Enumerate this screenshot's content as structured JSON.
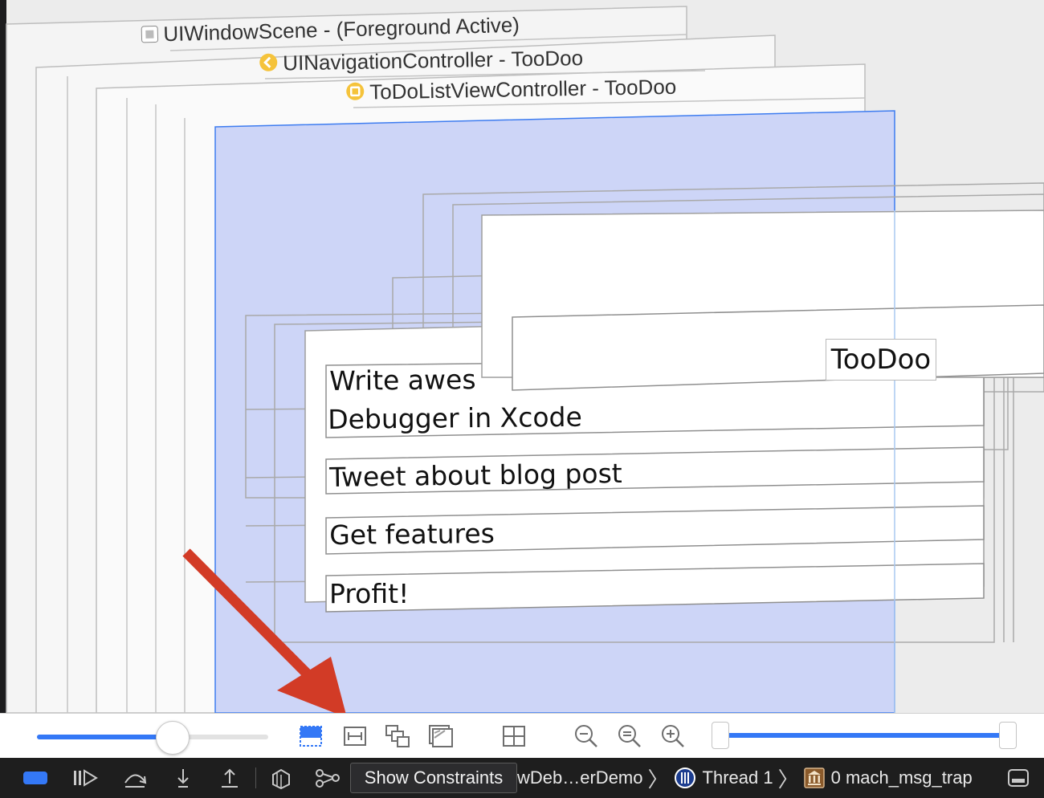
{
  "scene": {
    "window_scene_label": "UIWindowScene - (Foreground Active)",
    "nav_controller_label": "UINavigationController - TooDoo",
    "list_controller_label": "ToDoListViewController - TooDoo",
    "nav_title": "TooDoo",
    "cells": [
      "Write awes",
      "Debugger in Xcode",
      "Tweet about blog post",
      "Get features",
      "Profit!"
    ]
  },
  "tooltip": {
    "text": "Show Constraints"
  },
  "debug_bar": {
    "breadcrumb_app": "wDeb…erDemo",
    "breadcrumb_thread": "Thread 1",
    "breadcrumb_frame": "0 mach_msg_trap"
  },
  "colors": {
    "accent": "#3478f6",
    "selection_fill": "#cdd5f7",
    "annotation_arrow": "#d23b26"
  },
  "toolbar": {
    "spacing_slider_value": 0.52,
    "range_slider_value": [
      0.0,
      1.0
    ]
  }
}
